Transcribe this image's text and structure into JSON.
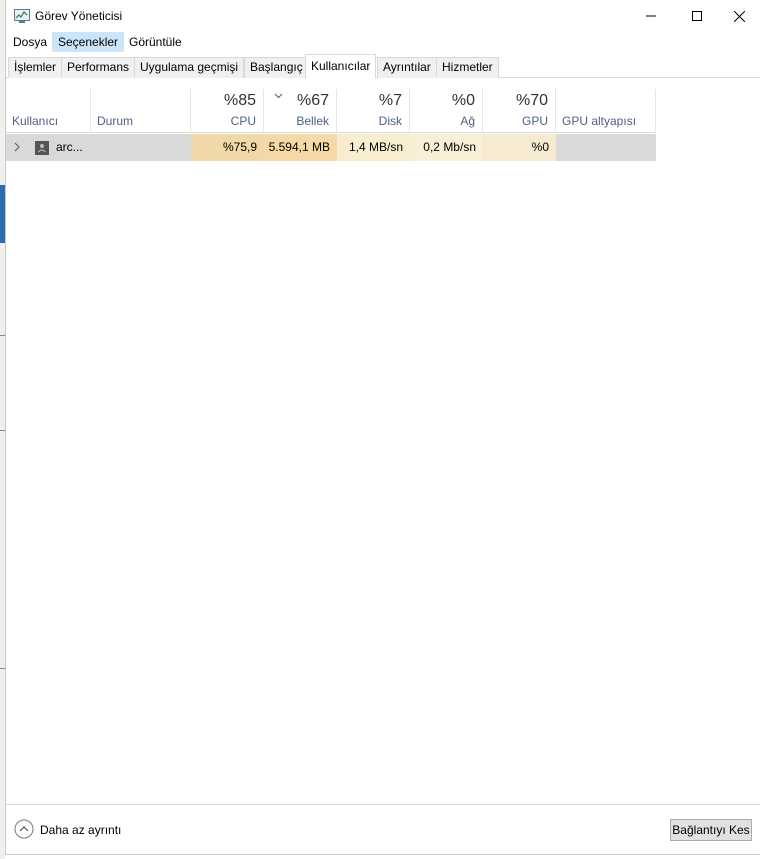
{
  "window": {
    "title": "Görev Yöneticisi"
  },
  "menu": [
    {
      "label": "Dosya"
    },
    {
      "label": "Seçenekler"
    },
    {
      "label": "Görüntüle"
    }
  ],
  "tabs": [
    {
      "label": "İşlemler"
    },
    {
      "label": "Performans"
    },
    {
      "label": "Uygulama geçmişi"
    },
    {
      "label": "Başlangıç"
    },
    {
      "label": "Kullanıcılar"
    },
    {
      "label": "Ayrıntılar"
    },
    {
      "label": "Hizmetler"
    }
  ],
  "active_tab": "Kullanıcılar",
  "columns": {
    "user": {
      "label": "Kullanıcı"
    },
    "status": {
      "label": "Durum"
    },
    "cpu": {
      "pct": "%85",
      "label": "CPU"
    },
    "memory": {
      "pct": "%67",
      "label": "Bellek"
    },
    "disk": {
      "pct": "%7",
      "label": "Disk"
    },
    "network": {
      "pct": "%0",
      "label": "Ağ"
    },
    "gpu": {
      "pct": "%70",
      "label": "GPU"
    },
    "gpu_engine": {
      "label": "GPU altyapısı"
    }
  },
  "rows": [
    {
      "user": "arc...",
      "status": "",
      "cpu": "%75,9",
      "memory": "5.594,1 MB",
      "disk": "1,4 MB/sn",
      "network": "0,2 Mb/sn",
      "gpu": "%0",
      "gpu_engine": ""
    }
  ],
  "footer": {
    "fewer_details": "Daha az ayrıntı",
    "disconnect": "Bağlantıyı Kes"
  },
  "colors": {
    "heat_cpu": "#f0d8a8",
    "heat_memory": "#f5d9a6",
    "heat_disk": "#f8edcf",
    "heat_network": "#f8efd6",
    "heat_gpu": "#f6ebd0",
    "row_bg": "#d9d9d9",
    "header_label": "#4d6082",
    "menu_active": "#cce4f7"
  }
}
